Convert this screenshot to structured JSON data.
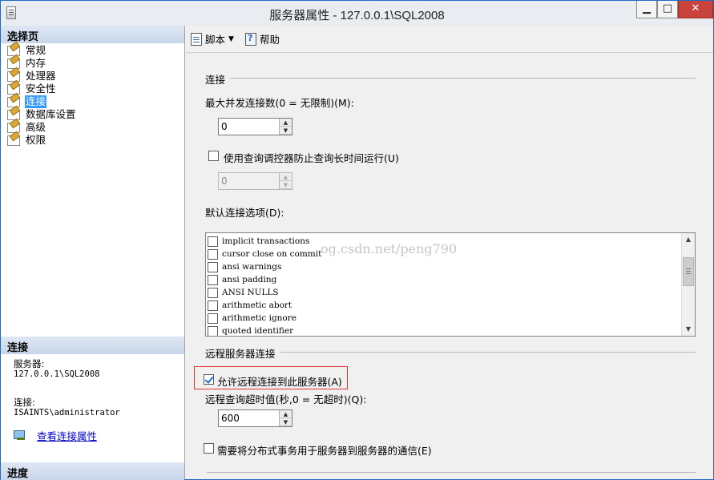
{
  "window": {
    "title": "服务器属性 - 127.0.0.1\\SQL2008",
    "min_label": "▁",
    "max_label": "□",
    "close_label": "✕"
  },
  "left_panel": {
    "pages_header": "选择页",
    "pages": [
      {
        "label": "常规",
        "selected": false
      },
      {
        "label": "内存",
        "selected": false
      },
      {
        "label": "处理器",
        "selected": false
      },
      {
        "label": "安全性",
        "selected": false
      },
      {
        "label": "连接",
        "selected": true
      },
      {
        "label": "数据库设置",
        "selected": false
      },
      {
        "label": "高级",
        "selected": false
      },
      {
        "label": "权限",
        "selected": false
      }
    ],
    "connection_header": "连接",
    "server_label": "服务器:",
    "server_value": "127.0.0.1\\SQL2008",
    "connection_label": "连接:",
    "connection_value": "ISAINTS\\administrator",
    "view_link": "查看连接属性",
    "progress_header": "进度"
  },
  "toolbar": {
    "script_label": "脚本",
    "help_label": "帮助"
  },
  "content": {
    "connections_group": "连接",
    "max_connections_label": "最大并发连接数(0 = 无限制)(M):",
    "max_connections_value": "0",
    "query_governor_label": "使用查询调控器防止查询长时间运行(U)",
    "query_governor_checked": false,
    "query_governor_value": "0",
    "default_options_label": "默认连接选项(D):",
    "default_options": [
      {
        "label": "implicit transactions",
        "checked": false
      },
      {
        "label": "cursor close on commit",
        "checked": false
      },
      {
        "label": "ansi warnings",
        "checked": false
      },
      {
        "label": "ansi padding",
        "checked": false
      },
      {
        "label": "ANSI NULLS",
        "checked": false
      },
      {
        "label": "arithmetic abort",
        "checked": false
      },
      {
        "label": "arithmetic ignore",
        "checked": false
      },
      {
        "label": "quoted identifier",
        "checked": false
      }
    ],
    "watermark": "og.csdn.net/peng790",
    "remote_group": "远程服务器连接",
    "allow_remote_label": "允许远程连接到此服务器(A)",
    "allow_remote_checked": true,
    "remote_timeout_label": "远程查询超时值(秒,0 = 无超时)(Q):",
    "remote_timeout_value": "600",
    "distributed_tx_label": "需要将分布式事务用于服务器到服务器的通信(E)",
    "distributed_tx_checked": false
  },
  "colors": {
    "selection": "#3399ff",
    "link": "#0000cc",
    "highlight_border": "#e03131",
    "close_button": "#c7433c"
  }
}
